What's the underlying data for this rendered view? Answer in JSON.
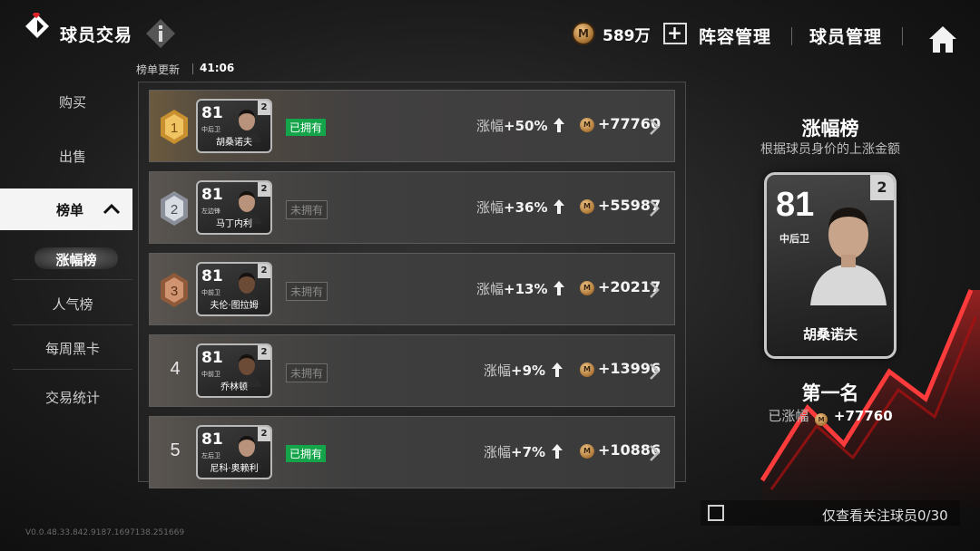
{
  "header": {
    "title": "球员交易",
    "coins": "589万",
    "coin_symbol": "M",
    "plus": "+",
    "nav_lineup": "阵容管理",
    "nav_players": "球员管理"
  },
  "leaderboard": {
    "update_label": "榜单更新",
    "update_time": "41:06"
  },
  "sidebar": {
    "buy": "购买",
    "sell": "出售",
    "rankings": "榜单",
    "sub_rise": "涨幅榜",
    "sub_popular": "人气榜",
    "sub_weekly": "每周黑卡",
    "stats": "交易统计"
  },
  "rows": [
    {
      "rank": "1",
      "rating": "81",
      "position": "中后卫",
      "name": "胡桑诺夫",
      "badge": "2",
      "ownership": "已拥有",
      "rise_label": "涨幅",
      "rise_value": "+50%",
      "amount": "+77760"
    },
    {
      "rank": "2",
      "rating": "81",
      "position": "左边锋",
      "name": "马丁内利",
      "badge": "2",
      "ownership": "未拥有",
      "rise_label": "涨幅",
      "rise_value": "+36%",
      "amount": "+55987"
    },
    {
      "rank": "3",
      "rating": "81",
      "position": "中前卫",
      "name": "夫伦·图拉姆",
      "badge": "2",
      "ownership": "未拥有",
      "rise_label": "涨幅",
      "rise_value": "+13%",
      "amount": "+20217"
    },
    {
      "rank": "4",
      "rating": "81",
      "position": "中前卫",
      "name": "乔林顿",
      "badge": "2",
      "ownership": "未拥有",
      "rise_label": "涨幅",
      "rise_value": "+9%",
      "amount": "+13996"
    },
    {
      "rank": "5",
      "rating": "81",
      "position": "左后卫",
      "name": "尼科·奥赖利",
      "badge": "2",
      "ownership": "已拥有",
      "rise_label": "涨幅",
      "rise_value": "+7%",
      "amount": "+10886"
    }
  ],
  "detail": {
    "title": "涨幅榜",
    "subtitle": "根据球员身价的上涨金额",
    "rating": "81",
    "position": "中后卫",
    "badge": "2",
    "name": "胡桑诺夫",
    "place": "第一名",
    "gain_label": "已涨幅",
    "gain_value": "+77760"
  },
  "footer": {
    "follow_label": "仅查看关注球员0/30",
    "version": "V0.0.48.33.842.9187.1697138.251669"
  },
  "colors": {
    "owned_green": "#14a44a",
    "accent_red": "#e0242c",
    "gold": "#c8902f"
  }
}
